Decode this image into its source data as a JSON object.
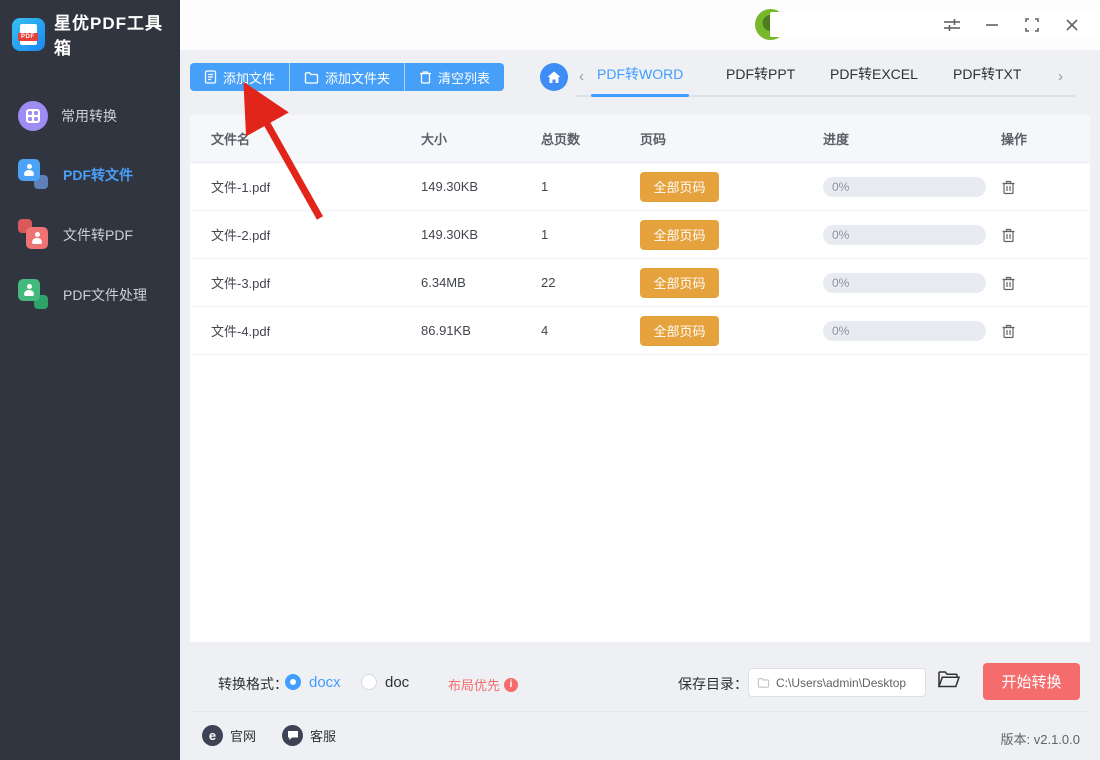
{
  "app": {
    "title": "星优PDF工具箱"
  },
  "sidebar": {
    "items": [
      {
        "label": "常用转换",
        "icon": "apps-grid-icon",
        "active": false
      },
      {
        "label": "PDF转文件",
        "icon": "pdf-to-file-icon",
        "active": true
      },
      {
        "label": "文件转PDF",
        "icon": "file-to-pdf-icon",
        "active": false
      },
      {
        "label": "PDF文件处理",
        "icon": "pdf-process-icon",
        "active": false
      }
    ]
  },
  "titlebar": {
    "icons": [
      "settings-sliders-icon",
      "minimize-icon",
      "maximize-icon",
      "close-icon"
    ]
  },
  "toolbar": {
    "buttons": [
      {
        "label": "添加文件",
        "icon": "file-icon"
      },
      {
        "label": "添加文件夹",
        "icon": "folder-icon"
      },
      {
        "label": "清空列表",
        "icon": "trash-icon"
      }
    ]
  },
  "tabs": {
    "active": "PDF转WORD",
    "items": [
      {
        "label": "PDF转WORD"
      },
      {
        "label": "PDF转PPT"
      },
      {
        "label": "PDF转EXCEL"
      },
      {
        "label": "PDF转TXT"
      }
    ]
  },
  "table": {
    "headers": [
      "文件名",
      "大小",
      "总页数",
      "页码",
      "进度",
      "操作"
    ],
    "rows": [
      {
        "name": "文件-1.pdf",
        "size": "149.30KB",
        "pages": "1",
        "page_range": "全部页码",
        "progress": "0%"
      },
      {
        "name": "文件-2.pdf",
        "size": "149.30KB",
        "pages": "1",
        "page_range": "全部页码",
        "progress": "0%"
      },
      {
        "name": "文件-3.pdf",
        "size": "6.34MB",
        "pages": "22",
        "page_range": "全部页码",
        "progress": "0%"
      },
      {
        "name": "文件-4.pdf",
        "size": "86.91KB",
        "pages": "4",
        "page_range": "全部页码",
        "progress": "0%"
      }
    ]
  },
  "controls": {
    "format_label": "转换格式：",
    "options": [
      {
        "label": "docx",
        "selected": true
      },
      {
        "label": "doc",
        "selected": false
      }
    ],
    "layout_priority": "布局优先",
    "info_icon_glyph": "i",
    "save_dir_label": "保存目录：",
    "save_path": "C:\\Users\\admin\\Desktop",
    "start_label": "开始转换"
  },
  "footer": {
    "website": "官网",
    "website_glyph": "e",
    "support": "客服",
    "version": "版本: v2.1.0.0"
  },
  "colors": {
    "sidebar_bg": "#31353f",
    "toolbar_blue": "#47a0f7",
    "tab_active_blue": "#409eff",
    "page_btn_orange": "#e6a23c",
    "start_btn_red": "#f56c6c",
    "arrow_red": "#e1251b",
    "progress_track": "#e9ebf2"
  }
}
